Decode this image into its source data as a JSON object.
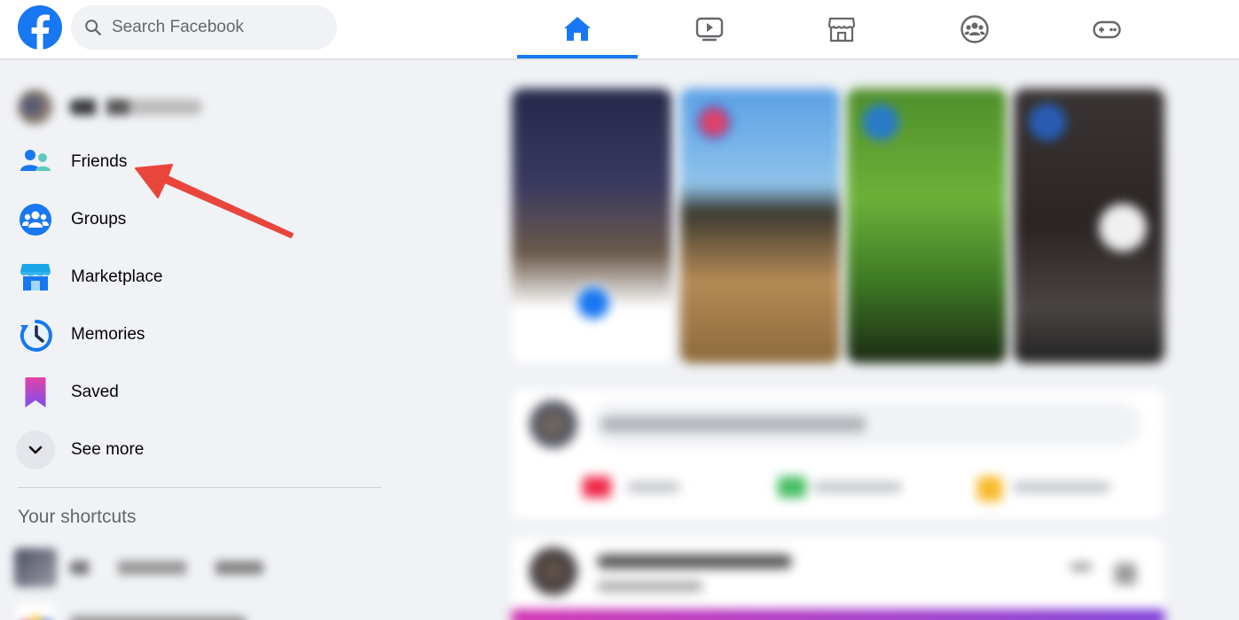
{
  "app": {
    "brand_color": "#1877f2"
  },
  "search": {
    "placeholder": "Search Facebook"
  },
  "nav": {
    "tabs": [
      {
        "name": "Home",
        "icon": "home-icon",
        "active": true
      },
      {
        "name": "Watch",
        "icon": "video-icon",
        "active": false
      },
      {
        "name": "Marketplace",
        "icon": "store-icon",
        "active": false
      },
      {
        "name": "Groups",
        "icon": "groups-icon",
        "active": false
      },
      {
        "name": "Gaming",
        "icon": "gamepad-icon",
        "active": false
      }
    ]
  },
  "sidebar": {
    "items": [
      {
        "label": "Friends",
        "icon": "friends-icon"
      },
      {
        "label": "Groups",
        "icon": "groups-icon"
      },
      {
        "label": "Marketplace",
        "icon": "marketplace-icon"
      },
      {
        "label": "Memories",
        "icon": "memories-icon"
      },
      {
        "label": "Saved",
        "icon": "saved-icon"
      },
      {
        "label": "See more",
        "icon": "chevron-down-icon"
      }
    ],
    "shortcuts_title": "Your shortcuts"
  },
  "annotation": {
    "color": "#e8463c"
  }
}
